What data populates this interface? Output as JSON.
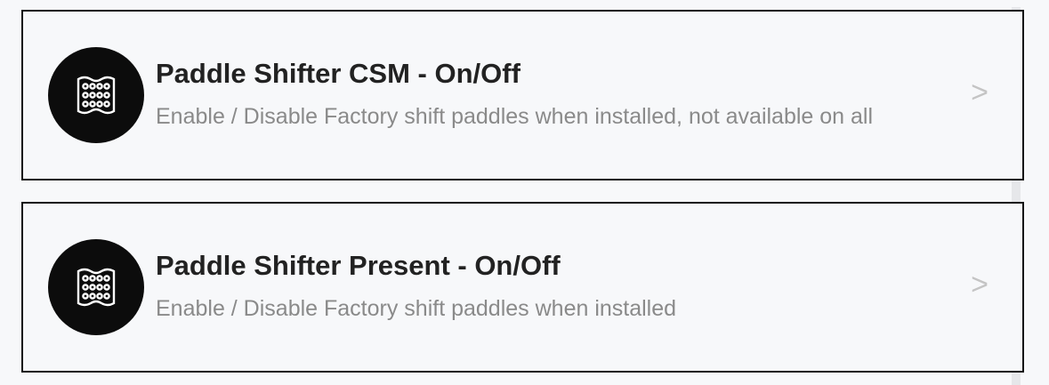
{
  "settings": {
    "items": [
      {
        "title": "Paddle Shifter CSM - On/Off",
        "description": "Enable / Disable Factory shift paddles when installed, not available on all",
        "icon": "paddle-shifter-icon",
        "chevron": ">"
      },
      {
        "title": "Paddle Shifter Present - On/Off",
        "description": "Enable / Disable Factory shift paddles when installed",
        "icon": "paddle-shifter-icon",
        "chevron": ">"
      }
    ]
  },
  "colors": {
    "background": "#f7f8fa",
    "card_border": "#111111",
    "icon_circle": "#0c0c0c",
    "title": "#222222",
    "description": "#8a8a8a",
    "chevron": "#c4c4c4"
  }
}
